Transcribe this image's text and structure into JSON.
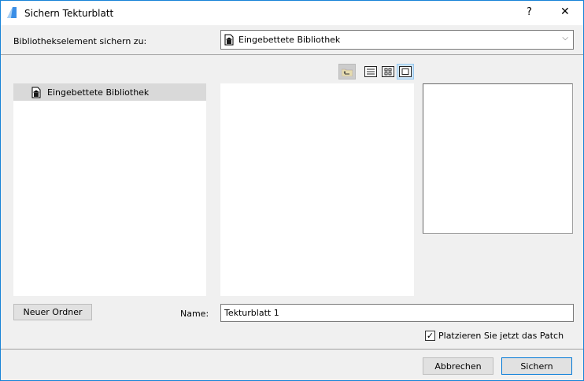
{
  "window": {
    "title": "Sichern Tekturblatt",
    "help": "?",
    "close": "✕"
  },
  "header": {
    "label": "Bibliothekselement sichern zu:",
    "combo_value": "Eingebettete Bibliothek"
  },
  "tree": {
    "items": [
      {
        "label": "Eingebettete Bibliothek",
        "selected": true
      }
    ]
  },
  "left_button": "Neuer Ordner",
  "name": {
    "label": "Name:",
    "value": "Tekturblatt 1"
  },
  "checkbox": {
    "label": "Platzieren Sie jetzt das Patch",
    "checked": true
  },
  "footer": {
    "cancel": "Abbrechen",
    "save": "Sichern"
  },
  "colors": {
    "accent": "#0078d7",
    "selected_row": "#d9d9d9",
    "toggle_active": "#cce4f7"
  }
}
